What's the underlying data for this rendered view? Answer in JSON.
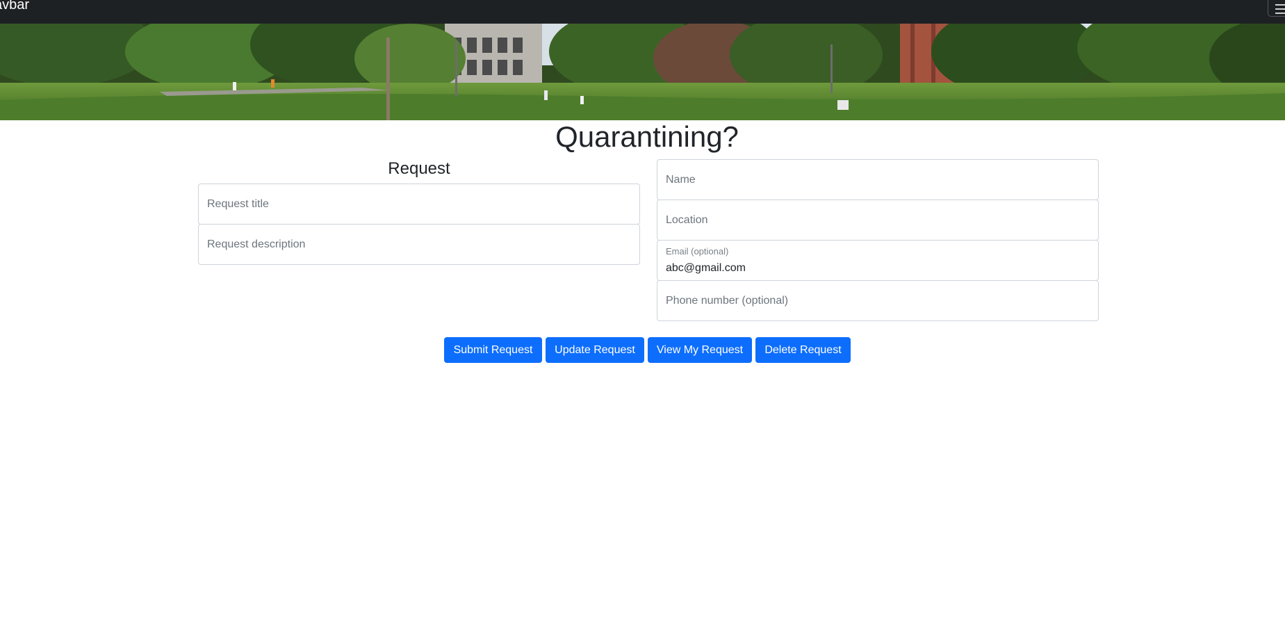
{
  "navbar": {
    "brand": "avbar",
    "toggler_icon": "hamburger-icon"
  },
  "banner": {
    "description_icon": "campus-banner-image"
  },
  "page": {
    "title": "Quarantining?"
  },
  "request": {
    "heading": "Request",
    "title_placeholder": "Request title",
    "description_placeholder": "Request description"
  },
  "contact": {
    "name_placeholder": "Name",
    "location_placeholder": "Location",
    "email_label": "Email (optional)",
    "email_value": "abc@gmail.com",
    "phone_placeholder": "Phone number (optional)"
  },
  "actions": {
    "submit": "Submit Request",
    "update": "Update Request",
    "view": "View My Request",
    "delete": "Delete Request"
  },
  "colors": {
    "navbar": "#1e2124",
    "primary": "#0d6efd"
  }
}
